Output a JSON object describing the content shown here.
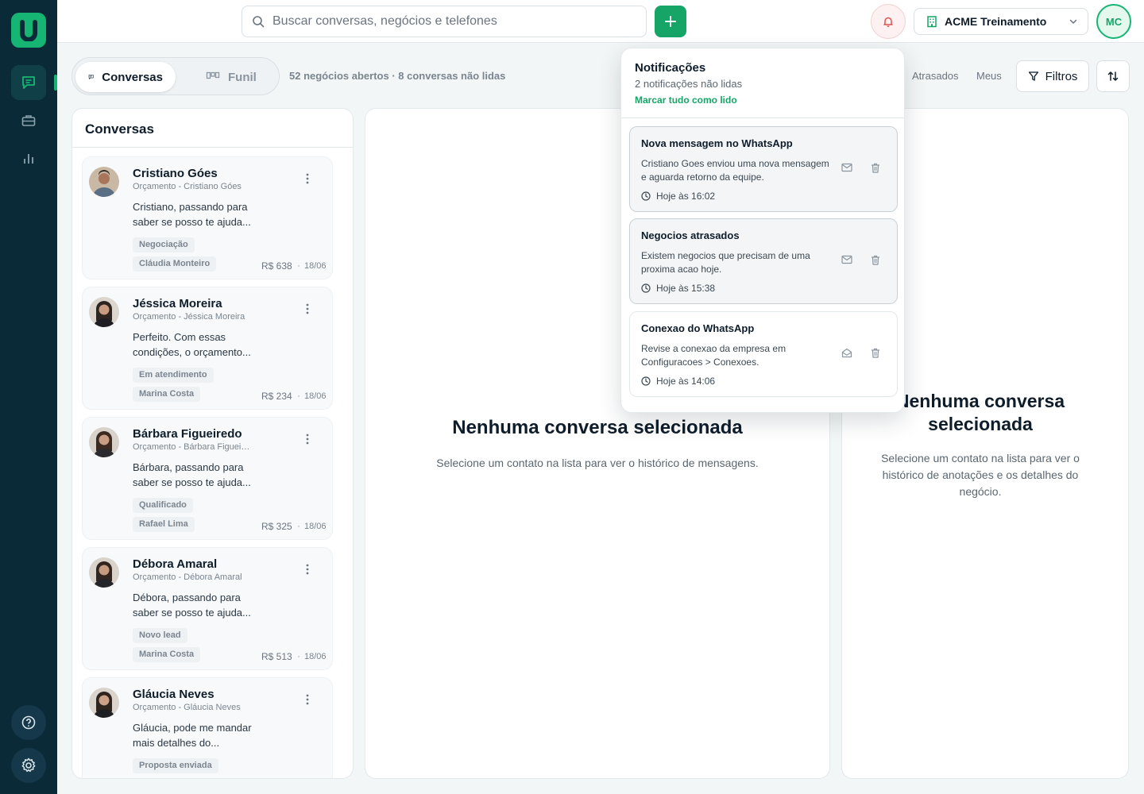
{
  "app": {
    "logo": "U"
  },
  "sidebar": {
    "items": [
      {
        "name": "chat-icon",
        "active": true
      },
      {
        "name": "briefcase-icon",
        "active": false
      },
      {
        "name": "chart-icon",
        "active": false
      }
    ],
    "bottom": [
      {
        "name": "help-icon"
      },
      {
        "name": "settings-icon"
      }
    ]
  },
  "header": {
    "search_placeholder": "Buscar conversas, negócios e telefones",
    "add_icon": "plus-icon",
    "bell_icon": "bell-icon",
    "company": "ACME Treinamento",
    "user_initials": "MC"
  },
  "toolbar": {
    "tab_conversas": "Conversas",
    "tab_funil": "Funil",
    "stats": "52 negócios abertos · 8 conversas não lidas",
    "filter_atrasados": "Atrasados",
    "filter_meus": "Meus",
    "filters_label": "Filtros"
  },
  "conversations": {
    "title": "Conversas",
    "items": [
      {
        "name": "Cristiano Góes",
        "sub": "Orçamento - Cristiano Góes",
        "msg": "Cristiano, passando para saber se posso te ajuda...",
        "stage": "Negociação",
        "owner": "Cláudia Monteiro",
        "value": "R$ 638",
        "dot": "·",
        "date": "18/06"
      },
      {
        "name": "Jéssica Moreira",
        "sub": "Orçamento - Jéssica Moreira",
        "msg": "Perfeito. Com essas condições, o orçamento...",
        "stage": "Em atendimento",
        "owner": "Marina Costa",
        "value": "R$ 234",
        "dot": "·",
        "date": "18/06"
      },
      {
        "name": "Bárbara Figueiredo",
        "sub": "Orçamento - Bárbara Figueiredo",
        "msg": "Bárbara, passando para saber se posso te ajuda...",
        "stage": "Qualificado",
        "owner": "Rafael Lima",
        "value": "R$ 325",
        "dot": "·",
        "date": "18/06"
      },
      {
        "name": "Débora Amaral",
        "sub": "Orçamento - Débora Amaral",
        "msg": "Débora, passando para saber se posso te ajuda...",
        "stage": "Novo lead",
        "owner": "Marina Costa",
        "value": "R$ 513",
        "dot": "·",
        "date": "18/06"
      },
      {
        "name": "Gláucia Neves",
        "sub": "Orçamento - Gláucia Neves",
        "msg": "Gláucia, pode me mandar mais detalhes do...",
        "stage": "Proposta enviada",
        "owner": "",
        "value": "",
        "dot": "",
        "date": ""
      }
    ]
  },
  "center": {
    "title": "Nenhuma conversa selecionada",
    "subtitle": "Selecione um contato na lista para ver o histórico de mensagens."
  },
  "right": {
    "title": "Nenhuma conversa selecionada",
    "subtitle": "Selecione um contato na lista para ver o histórico de anotações e os detalhes do negócio."
  },
  "notifications": {
    "title": "Notificações",
    "count": "2 notificações não lidas",
    "mark_all": "Marcar tudo como lido",
    "items": [
      {
        "title": "Nova mensagem no WhatsApp",
        "body": "Cristiano Goes enviou uma nova mensagem e aguarda retorno da equipe.",
        "time": "Hoje às 16:02",
        "unread": true,
        "action_icon": "mail-icon"
      },
      {
        "title": "Negocios atrasados",
        "body": "Existem negocios que precisam de uma proxima acao hoje.",
        "time": "Hoje às 15:38",
        "unread": true,
        "action_icon": "mail-icon"
      },
      {
        "title": "Conexao do WhatsApp",
        "body": "Revise a conexao da empresa em Configuracoes > Conexoes.",
        "time": "Hoje às 14:06",
        "unread": false,
        "action_icon": "mail-open-icon"
      }
    ]
  },
  "colors": {
    "brand": "#16a567",
    "sidebar": "#0b2a38",
    "alert": "#e05252"
  }
}
